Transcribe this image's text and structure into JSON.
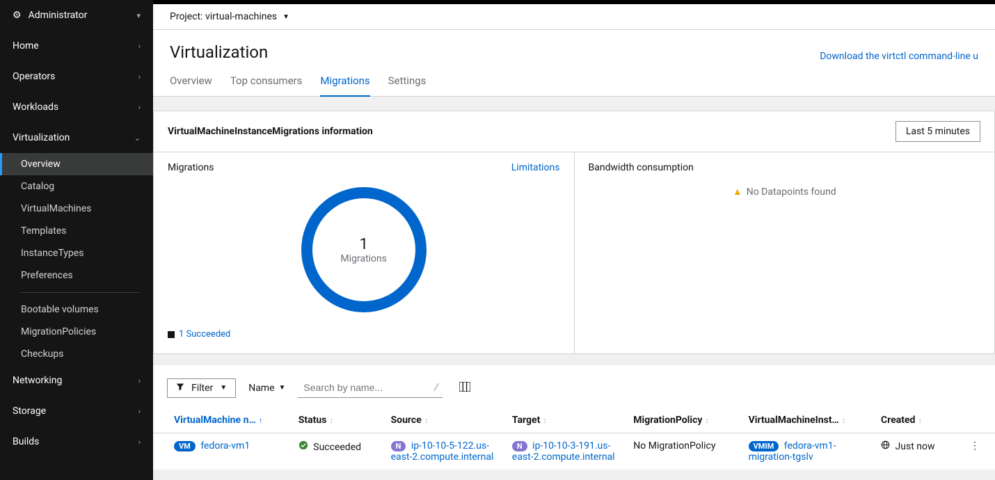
{
  "sidebar": {
    "admin_label": "Administrator",
    "items": [
      {
        "label": "Home",
        "chev": "›"
      },
      {
        "label": "Operators",
        "chev": "›"
      },
      {
        "label": "Workloads",
        "chev": "›"
      }
    ],
    "virtualization_label": "Virtualization",
    "virt_sub": [
      {
        "label": "Overview",
        "active": true
      },
      {
        "label": "Catalog"
      },
      {
        "label": "VirtualMachines"
      },
      {
        "label": "Templates"
      },
      {
        "label": "InstanceTypes"
      },
      {
        "label": "Preferences"
      }
    ],
    "virt_sub2": [
      {
        "label": "Bootable volumes"
      },
      {
        "label": "MigrationPolicies"
      },
      {
        "label": "Checkups"
      }
    ],
    "items2": [
      {
        "label": "Networking",
        "chev": "›"
      },
      {
        "label": "Storage",
        "chev": "›"
      },
      {
        "label": "Builds",
        "chev": "›"
      }
    ]
  },
  "project": {
    "label": "Project: virtual-machines"
  },
  "header": {
    "title": "Virtualization",
    "download": "Download the virtctl command-line u"
  },
  "tabs": [
    {
      "label": "Overview"
    },
    {
      "label": "Top consumers"
    },
    {
      "label": "Migrations",
      "active": true
    },
    {
      "label": "Settings"
    }
  ],
  "card": {
    "title": "VirtualMachineInstanceMigrations information",
    "time_range": "Last 5 minutes",
    "migrations_label": "Migrations",
    "limitations": "Limitations",
    "donut_value": "1",
    "donut_label": "Migrations",
    "legend": "1 Succeeded",
    "bandwidth_label": "Bandwidth consumption",
    "no_data": "No Datapoints found"
  },
  "toolbar": {
    "filter": "Filter",
    "name": "Name",
    "search_placeholder": "Search by name..."
  },
  "table": {
    "cols": {
      "vm": "VirtualMachine n…",
      "status": "Status",
      "source": "Source",
      "target": "Target",
      "policy": "MigrationPolicy",
      "vmim": "VirtualMachineInst…",
      "created": "Created"
    },
    "row": {
      "vm_badge": "VM",
      "vm_name": "fedora-vm1",
      "status": "Succeeded",
      "source_badge": "N",
      "source": "ip-10-10-5-122.us-east-2.compute.internal",
      "target_badge": "N",
      "target": "ip-10-10-3-191.us-east-2.compute.internal",
      "policy": "No MigrationPolicy",
      "vmim_badge": "VMIM",
      "vmim": "fedora-vm1-migration-tgslv",
      "created": "Just now"
    }
  }
}
